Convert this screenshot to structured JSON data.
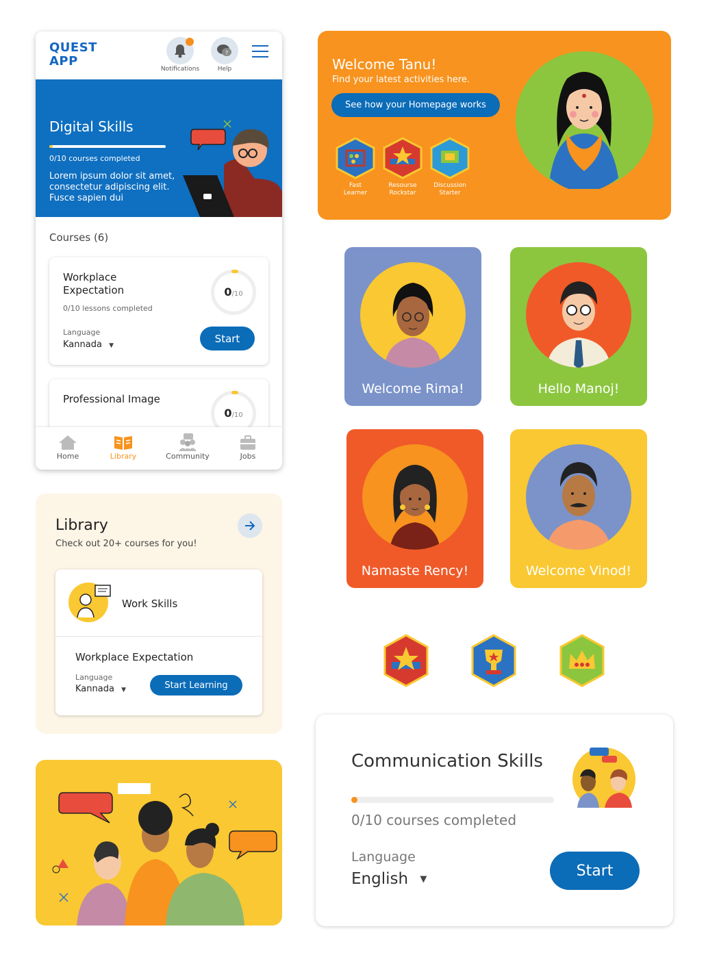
{
  "phone": {
    "logo_line1": "QUEST",
    "logo_line2": "APP",
    "notifications_label": "Notifications",
    "help_label": "Help",
    "hero": {
      "title": "Digital Skills",
      "progress_text": "0/10 courses completed",
      "progress_fraction": 0.03,
      "desc1": "Lorem ipsum dolor sit amet,",
      "desc2": "consectetur adipiscing elit.",
      "desc3": "Fusce sapien dui"
    },
    "courses_heading": "Courses (6)",
    "course1": {
      "title1": "Workplace",
      "title2": "Expectation",
      "lessons": "0/10 lessons completed",
      "ring_value": "0",
      "ring_total": "/10",
      "language_label": "Language",
      "language_value": "Kannada",
      "start_label": "Start"
    },
    "course2": {
      "title": "Professional Image",
      "ring_value": "0",
      "ring_total": "/10"
    },
    "nav": {
      "home": "Home",
      "library": "Library",
      "community": "Community",
      "jobs": "Jobs"
    }
  },
  "welcome_card": {
    "title": "Welcome Tanu!",
    "subtitle": "Find your latest activities here.",
    "button": "See how your Homepage works",
    "badges": [
      {
        "l1": "Fast",
        "l2": "Learner"
      },
      {
        "l1": "Resourse",
        "l2": "Rockstar"
      },
      {
        "l1": "Discussion",
        "l2": "Starter"
      }
    ]
  },
  "tiles": [
    {
      "text": "Welcome Rima!"
    },
    {
      "text": "Hello Manoj!"
    },
    {
      "text": "Namaste Rency!"
    },
    {
      "text": "Welcome Vinod!"
    }
  ],
  "library": {
    "title": "Library",
    "subtitle": "Check out 20+ courses for you!",
    "category": "Work Skills",
    "course": "Workplace Expectation",
    "language_label": "Language",
    "language_value": "Kannada",
    "button": "Start Learning"
  },
  "comm": {
    "title": "Communication Skills",
    "progress_text": "0/10 courses completed",
    "progress_fraction": 0.02,
    "language_label": "Language",
    "language_value": "English",
    "button": "Start"
  },
  "colors": {
    "primary": "#0b6cb8",
    "orange": "#f7931e",
    "green": "#8cc63f",
    "blue_tile": "#7b93c9",
    "red_tile": "#f05a28",
    "yellow": "#f9c832"
  },
  "icons": [
    "bell-icon",
    "help-chat-icon",
    "menu-icon",
    "home-icon",
    "book-icon",
    "community-icon",
    "briefcase-icon",
    "arrow-right-icon",
    "caret-down-icon"
  ]
}
